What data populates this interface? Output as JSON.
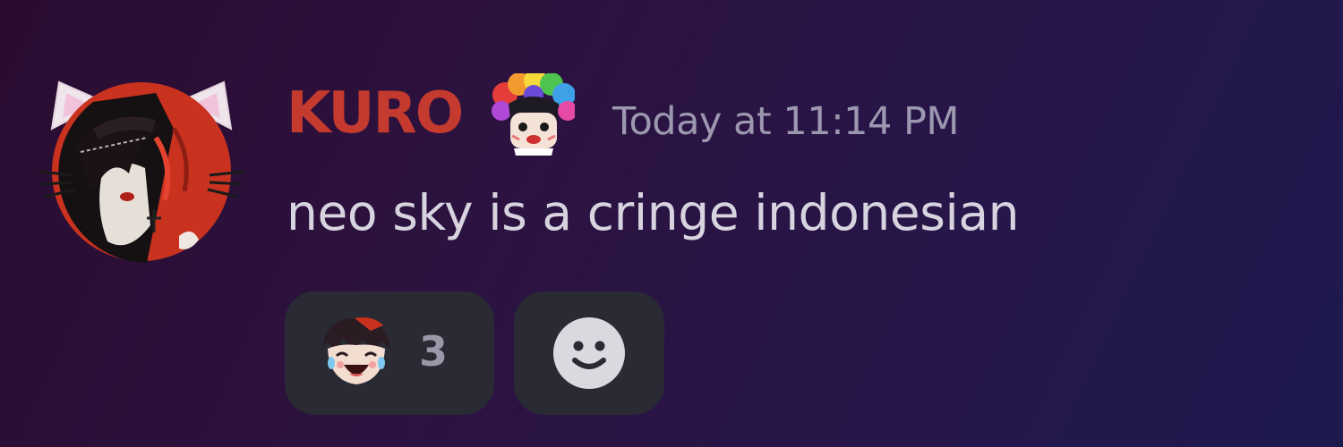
{
  "message": {
    "author": {
      "name": "KURO",
      "name_color": "#c43a2e",
      "avatar": "avatar-icon",
      "role_icon": "rainbow-hair-emoji-icon"
    },
    "timestamp": "Today at 11:14 PM",
    "content": "neo sky is a cringe indonesian",
    "reactions": [
      {
        "emoji": "laughing-character-emoji-icon",
        "count": "3"
      }
    ],
    "add_reaction_icon": "smiley-face-icon"
  },
  "colors": {
    "background_start": "#2a0c30",
    "background_end": "#1d1a4e",
    "timestamp": "#9c98b0",
    "text": "#d7d4e0",
    "pill": "#292a34"
  }
}
